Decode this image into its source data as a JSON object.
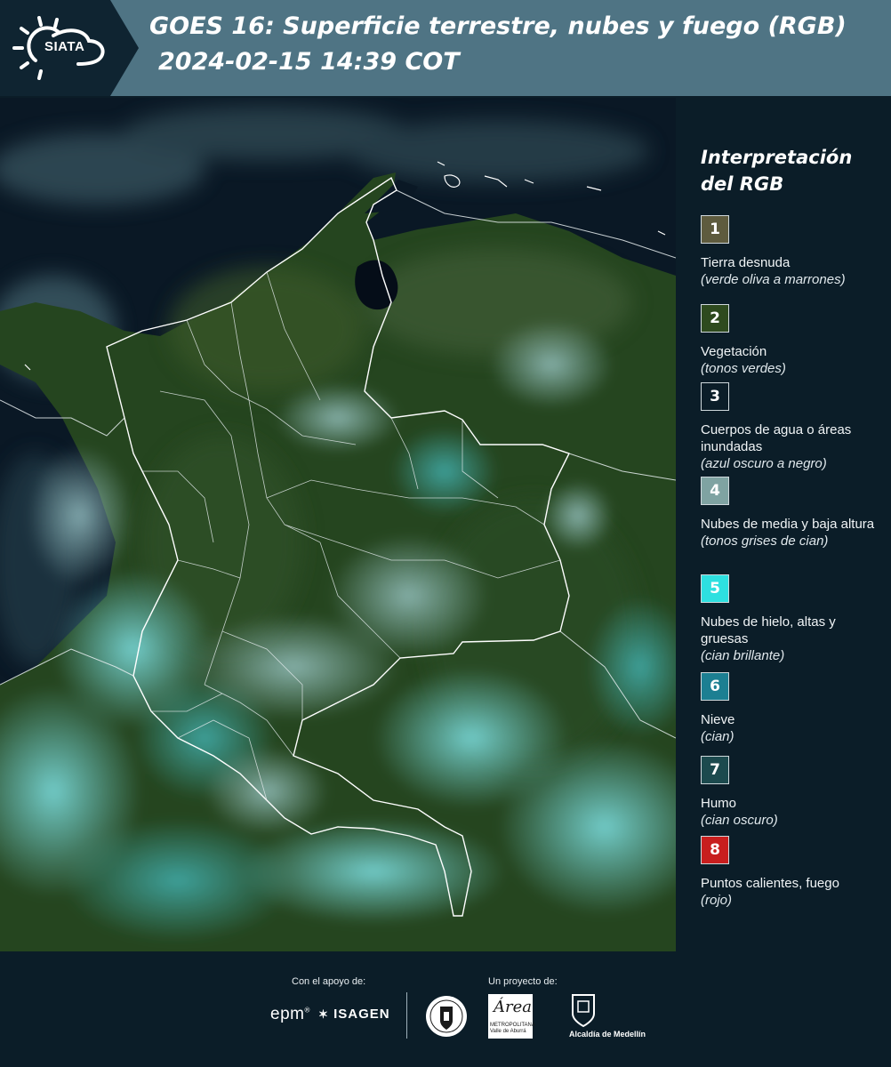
{
  "header": {
    "logo_text": "SIATA",
    "title": "GOES 16: Superficie terrestre, nubes y fuego (RGB)",
    "datetime": "2024-02-15 14:39 COT"
  },
  "legend": {
    "title_line1": "Interpretación",
    "title_line2": "del RGB",
    "items": [
      {
        "number": "1",
        "color": "#5e5b3e",
        "label": "Tierra desnuda",
        "sub": "(verde oliva a marrones)"
      },
      {
        "number": "2",
        "color": "#2e4a1e",
        "label": "Vegetación",
        "sub": "(tonos verdes)"
      },
      {
        "number": "3",
        "color": "#0b1d28",
        "label": "Cuerpos de agua o áreas inundadas",
        "sub": "(azul oscuro a negro)"
      },
      {
        "number": "4",
        "color": "#7fa3a2",
        "label": "Nubes de media y baja altura",
        "sub": "(tonos grises de cian)"
      },
      {
        "number": "5",
        "color": "#2ee0e0",
        "label": "Nubes de hielo, altas y gruesas",
        "sub": "(cian brillante)"
      },
      {
        "number": "6",
        "color": "#1c7f92",
        "label": "Nieve",
        "sub": "(cian)"
      },
      {
        "number": "7",
        "color": "#1c4a4e",
        "label": "Humo",
        "sub": "(cian oscuro)"
      },
      {
        "number": "8",
        "color": "#c81e1e",
        "label": "Puntos calientes, fuego",
        "sub": "(rojo)"
      }
    ]
  },
  "footer": {
    "support_label": "Con el apoyo de:",
    "project_label": "Un proyecto de:",
    "logo_epm": "epm",
    "logo_isagen": "ISAGEN",
    "logo_area": "Área",
    "logo_area_sub1": "METROPOLITANA",
    "logo_area_sub2": "Valle de Aburrá",
    "logo_medellin": "Alcaldía de Medellín"
  }
}
